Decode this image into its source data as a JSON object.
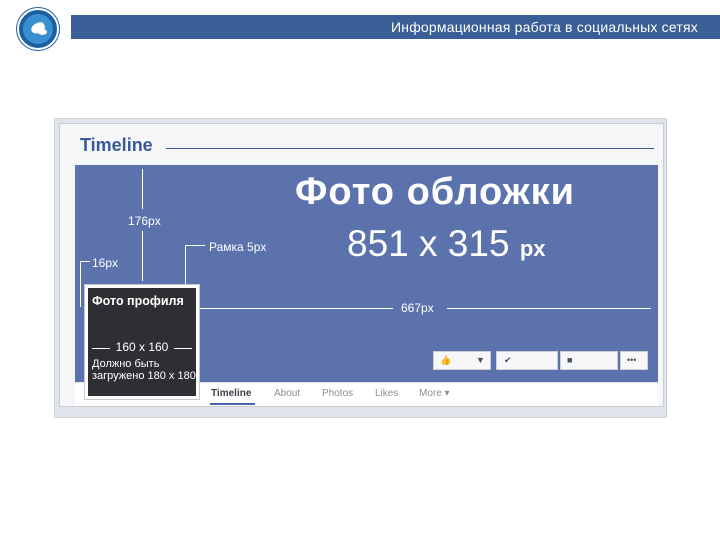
{
  "header": {
    "title": "Информационная работа в социальных сетях"
  },
  "icons": {
    "logo": "dove-emblem-icon",
    "like": "thumbs-up-icon",
    "dropdown": "caret-down-icon",
    "check": "check-icon",
    "message": "message-icon",
    "more": "ellipsis-icon"
  },
  "colors": {
    "header_bar": "#3a5f96",
    "cover": "#5b72ad",
    "brand": "#3b5998"
  },
  "panel": {
    "timeline_label": "Timeline"
  },
  "cover": {
    "title": "Фото обложки",
    "dims": "851 x 315",
    "unit": "px",
    "label_176": "176px",
    "label_16": "16px",
    "label_frame": "Рамка 5px",
    "label_667": "667px"
  },
  "profile": {
    "title": "Фото профиля",
    "size": "160 x 160",
    "note_line1": "Должно быть",
    "note_line2": "загружено 180 x 180"
  },
  "nav": {
    "items": [
      "Timeline",
      "About",
      "Photos",
      "Likes",
      "More ▾"
    ]
  }
}
